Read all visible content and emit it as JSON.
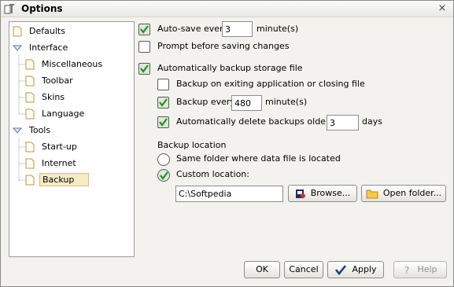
{
  "window": {
    "title": "Options",
    "close_glyph": "×"
  },
  "tree": {
    "items": [
      {
        "label": "Defaults",
        "icon": "page-icon"
      },
      {
        "label": "Interface",
        "icon": "expand-icon"
      },
      {
        "label": "Miscellaneous",
        "icon": "page-icon"
      },
      {
        "label": "Toolbar",
        "icon": "page-icon"
      },
      {
        "label": "Skins",
        "icon": "page-icon"
      },
      {
        "label": "Language",
        "icon": "page-icon"
      },
      {
        "label": "Tools",
        "icon": "expand-icon"
      },
      {
        "label": "Start-up",
        "icon": "page-icon"
      },
      {
        "label": "Internet",
        "icon": "page-icon"
      },
      {
        "label": "Backup",
        "icon": "page-icon",
        "selected": true
      }
    ]
  },
  "options": {
    "autosave": {
      "label": "Auto-save every",
      "value": "3",
      "unit": "minute(s)",
      "checked": true
    },
    "prompt": {
      "label": "Prompt before saving changes",
      "checked": false
    },
    "auto_backup": {
      "label": "Automatically backup storage file",
      "checked": true
    },
    "backup_on_exit": {
      "label": "Backup on exiting application or closing file",
      "checked": false
    },
    "backup_every": {
      "label": "Backup every",
      "value": "480",
      "unit": "minute(s)",
      "checked": true
    },
    "auto_delete": {
      "label": "Automatically delete backups older then",
      "value": "3",
      "unit": "days",
      "checked": true
    }
  },
  "backup_location": {
    "heading": "Backup location",
    "same_folder": {
      "label": "Same folder where data file is located",
      "selected": false
    },
    "custom": {
      "label": "Custom location:",
      "selected": true
    },
    "path": "C:\\Softpedia",
    "browse_label": "Browse...",
    "open_folder_label": "Open folder..."
  },
  "buttons": {
    "ok": "OK",
    "cancel": "Cancel",
    "apply": "Apply",
    "help": "Help"
  },
  "colors": {
    "check_green": "#2e8b2e",
    "selection_bg": "#f5ebc4",
    "folder_yellow": "#f2c94c"
  }
}
